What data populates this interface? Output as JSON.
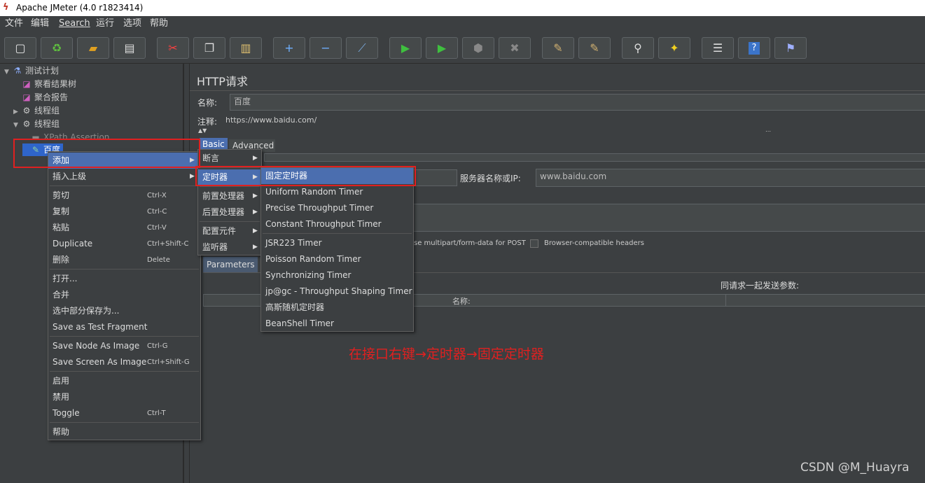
{
  "window": {
    "title": "Apache JMeter (4.0 r1823414)"
  },
  "menubar": [
    "文件",
    "编辑",
    "Search",
    "运行",
    "选项",
    "帮助"
  ],
  "toolbar": [
    {
      "icon": "new-icon",
      "glyph": "▢",
      "color": "#e8e8e8"
    },
    {
      "icon": "templates-icon",
      "glyph": "♻",
      "color": "#5fbf3f"
    },
    {
      "icon": "open-icon",
      "glyph": "▰",
      "color": "#e0a020"
    },
    {
      "icon": "save-icon",
      "glyph": "▤",
      "color": "#dddddd"
    },
    {
      "icon": "cut-icon",
      "glyph": "✂",
      "color": "#ff4040"
    },
    {
      "icon": "copy-icon",
      "glyph": "❐",
      "color": "#dddddd"
    },
    {
      "icon": "paste-icon",
      "glyph": "▥",
      "color": "#e0c070"
    },
    {
      "icon": "expand-icon",
      "glyph": "+",
      "color": "#6fb0ff"
    },
    {
      "icon": "collapse-icon",
      "glyph": "−",
      "color": "#6fb0ff"
    },
    {
      "icon": "toggle-icon",
      "glyph": "⟋",
      "color": "#7aaadd"
    },
    {
      "icon": "start-icon",
      "glyph": "▶",
      "color": "#3fbf3f"
    },
    {
      "icon": "start-no-pauses-icon",
      "glyph": "▶",
      "color": "#3fbf3f"
    },
    {
      "icon": "stop-icon",
      "glyph": "⬢",
      "color": "#888888"
    },
    {
      "icon": "shutdown-icon",
      "glyph": "✖",
      "color": "#888888"
    },
    {
      "icon": "clear-icon",
      "glyph": "✎",
      "color": "#d0b070"
    },
    {
      "icon": "clear-all-icon",
      "glyph": "✎",
      "color": "#d0b070"
    },
    {
      "icon": "search-icon",
      "glyph": "⚲",
      "color": "#dddddd"
    },
    {
      "icon": "reset-search-icon",
      "glyph": "✦",
      "color": "#f0d020"
    },
    {
      "icon": "function-helper-icon",
      "glyph": "☰",
      "color": "#dddddd"
    },
    {
      "icon": "help-icon",
      "glyph": "?",
      "color": "#ffffff"
    },
    {
      "icon": "remote-icon",
      "glyph": "⚑",
      "color": "#9fb0ff"
    }
  ],
  "tree": {
    "nodes": [
      {
        "label": "测试计划",
        "twisty": "▼",
        "icon": "test-plan-icon",
        "glyph": "⚗",
        "indent": 0
      },
      {
        "label": "察看结果树",
        "twisty": "",
        "icon": "listener-icon",
        "glyph": "◪",
        "indent": 1
      },
      {
        "label": "聚合报告",
        "twisty": "",
        "icon": "listener-icon",
        "glyph": "◪",
        "indent": 1
      },
      {
        "label": "线程组",
        "twisty": "▶",
        "icon": "thread-group-icon",
        "glyph": "⚙",
        "indent": 1
      },
      {
        "label": "线程组",
        "twisty": "▼",
        "icon": "thread-group-icon",
        "glyph": "⚙",
        "indent": 1
      },
      {
        "label": "XPath Assertion",
        "twisty": "",
        "icon": "assertion-icon",
        "glyph": "▬",
        "indent": 2
      },
      {
        "label": "百度",
        "twisty": "",
        "icon": "sampler-icon",
        "glyph": "✎",
        "indent": 2
      }
    ]
  },
  "panel": {
    "title": "HTTP请求",
    "name_label": "名称:",
    "name_value": "百度",
    "comment_label": "注释:",
    "comment_value": "https://www.baidu.com/",
    "tabs": [
      "Basic",
      "Advanced"
    ],
    "server_label": "服务器名称或IP:",
    "server_value": "www.baidu.com",
    "multipart_label": "se multipart/form-data for POST",
    "browser_headers_label": "Browser-compatible headers",
    "params_tab": "Parameters",
    "params_header": "同请求一起发送参数:",
    "params_col_name": "名称:"
  },
  "context_menu": {
    "items": [
      {
        "label": "添加",
        "arrow": true,
        "sep_before": false,
        "shortcut": ""
      },
      {
        "label": "插入上级",
        "arrow": true,
        "sep_before": false,
        "shortcut": ""
      },
      {
        "label": "剪切",
        "arrow": false,
        "sep_before": true,
        "shortcut": "Ctrl-X"
      },
      {
        "label": "复制",
        "arrow": false,
        "sep_before": false,
        "shortcut": "Ctrl-C"
      },
      {
        "label": "粘贴",
        "arrow": false,
        "sep_before": false,
        "shortcut": "Ctrl-V"
      },
      {
        "label": "Duplicate",
        "arrow": false,
        "sep_before": false,
        "shortcut": "Ctrl+Shift-C"
      },
      {
        "label": "删除",
        "arrow": false,
        "sep_before": false,
        "shortcut": "Delete"
      },
      {
        "label": "打开...",
        "arrow": false,
        "sep_before": true,
        "shortcut": ""
      },
      {
        "label": "合并",
        "arrow": false,
        "sep_before": false,
        "shortcut": ""
      },
      {
        "label": "选中部分保存为...",
        "arrow": false,
        "sep_before": false,
        "shortcut": ""
      },
      {
        "label": "Save as Test Fragment",
        "arrow": false,
        "sep_before": false,
        "shortcut": ""
      },
      {
        "label": "Save Node As Image",
        "arrow": false,
        "sep_before": true,
        "shortcut": "Ctrl-G"
      },
      {
        "label": "Save Screen As Image",
        "arrow": false,
        "sep_before": false,
        "shortcut": "Ctrl+Shift-G"
      },
      {
        "label": "启用",
        "arrow": false,
        "sep_before": true,
        "shortcut": ""
      },
      {
        "label": "禁用",
        "arrow": false,
        "sep_before": false,
        "shortcut": ""
      },
      {
        "label": "Toggle",
        "arrow": false,
        "sep_before": false,
        "shortcut": "Ctrl-T"
      },
      {
        "label": "帮助",
        "arrow": false,
        "sep_before": true,
        "shortcut": ""
      }
    ]
  },
  "add_submenu": {
    "items": [
      {
        "label": "断言",
        "sep_before": false
      },
      {
        "label": "定时器",
        "sep_before": true
      },
      {
        "label": "前置处理器",
        "sep_before": true
      },
      {
        "label": "后置处理器",
        "sep_before": false
      },
      {
        "label": "配置元件",
        "sep_before": true
      },
      {
        "label": "监听器",
        "sep_before": false
      }
    ]
  },
  "timer_submenu": {
    "items": [
      "固定定时器",
      "Uniform Random Timer",
      "Precise Throughput Timer",
      "Constant Throughput Timer",
      "JSR223 Timer",
      "Poisson Random Timer",
      "Synchronizing Timer",
      "jp@gc - Throughput Shaping Timer",
      "高斯随机定时器",
      "BeanShell Timer"
    ]
  },
  "annotation": "在接口右键→定时器→固定定时器",
  "watermark": "CSDN @M_Huayra",
  "colors": {
    "highlight": "#4b6eaf",
    "annotation_red": "#e02020"
  }
}
